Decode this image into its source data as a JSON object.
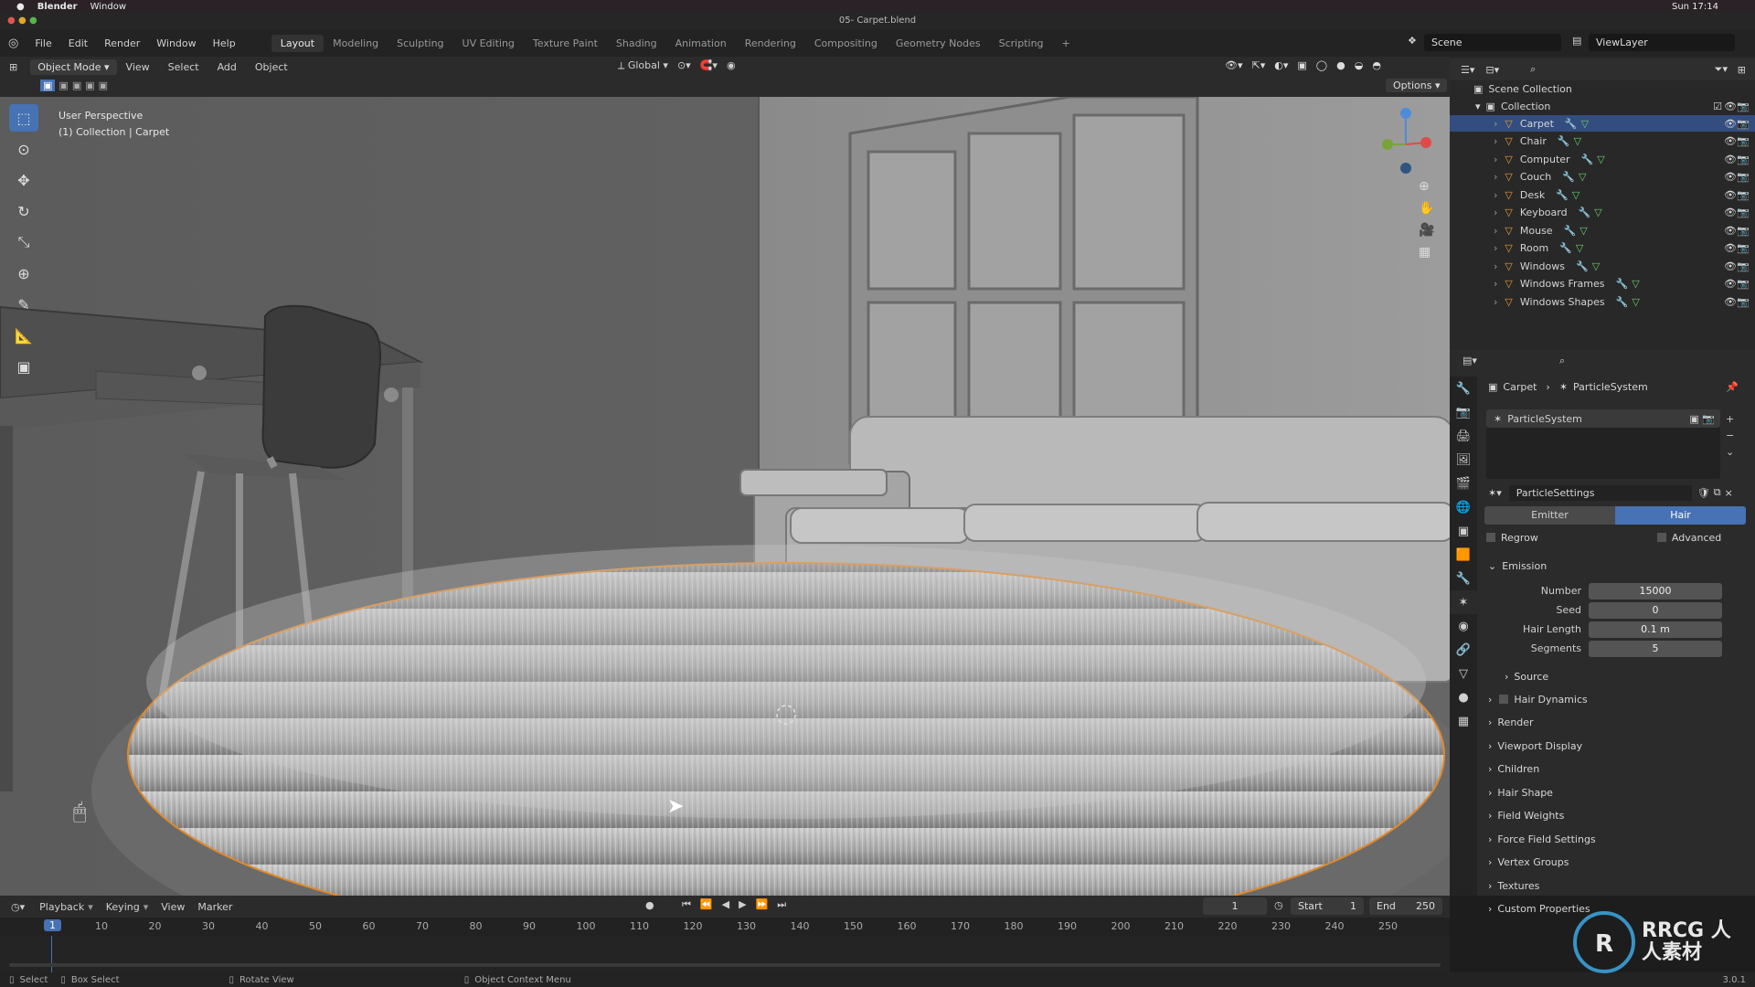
{
  "mac_menu": {
    "app": "Blender",
    "window": "Window",
    "clock": "Sun 17:14"
  },
  "title": "05- Carpet.blend",
  "top_menu": [
    "File",
    "Edit",
    "Render",
    "Window",
    "Help"
  ],
  "workspaces": [
    "Layout",
    "Modeling",
    "Sculpting",
    "UV Editing",
    "Texture Paint",
    "Shading",
    "Animation",
    "Rendering",
    "Compositing",
    "Geometry Nodes",
    "Scripting"
  ],
  "active_workspace": "Layout",
  "scene": "Scene",
  "view_layer": "ViewLayer",
  "viewport_header": {
    "mode": "Object Mode",
    "menus": [
      "View",
      "Select",
      "Add",
      "Object"
    ],
    "transform": "Global",
    "options": "Options"
  },
  "viewport_info": {
    "line1": "User Perspective",
    "line2": "(1) Collection | Carpet"
  },
  "outliner": {
    "root": "Scene Collection",
    "collection": "Collection",
    "items": [
      "Carpet",
      "Chair",
      "Computer",
      "Couch",
      "Desk",
      "Keyboard",
      "Mouse",
      "Room",
      "Windows",
      "Windows Frames",
      "Windows Shapes"
    ],
    "selected": "Carpet"
  },
  "properties": {
    "breadcrumb_object": "Carpet",
    "breadcrumb_system": "ParticleSystem",
    "system_name": "ParticleSystem",
    "settings_name": "ParticleSettings",
    "type_tabs": [
      "Emitter",
      "Hair"
    ],
    "active_type": "Hair",
    "regrow": "Regrow",
    "advanced": "Advanced",
    "emission_label": "Emission",
    "fields": [
      {
        "label": "Number",
        "value": "15000"
      },
      {
        "label": "Seed",
        "value": "0"
      },
      {
        "label": "Hair Length",
        "value": "0.1 m"
      },
      {
        "label": "Segments",
        "value": "5"
      }
    ],
    "source": "Source",
    "panels": [
      "Hair Dynamics",
      "Render",
      "Viewport Display",
      "Children",
      "Hair Shape",
      "Field Weights",
      "Force Field Settings",
      "Vertex Groups",
      "Textures",
      "Custom Properties"
    ]
  },
  "timeline": {
    "menus": [
      "Playback",
      "Keying",
      "View",
      "Marker"
    ],
    "current_frame": "1",
    "start_label": "Start",
    "start": "1",
    "end_label": "End",
    "end": "250",
    "ticks": [
      "10",
      "20",
      "30",
      "40",
      "50",
      "60",
      "70",
      "80",
      "90",
      "100",
      "110",
      "120",
      "130",
      "140",
      "150",
      "160",
      "170",
      "180",
      "190",
      "200",
      "210",
      "220",
      "230",
      "240",
      "250"
    ]
  },
  "status_bar": {
    "select": "Select",
    "box_select": "Box Select",
    "rotate": "Rotate View",
    "context": "Object Context Menu",
    "version": "3.0.1"
  },
  "watermark": "RRCG 人人素材"
}
